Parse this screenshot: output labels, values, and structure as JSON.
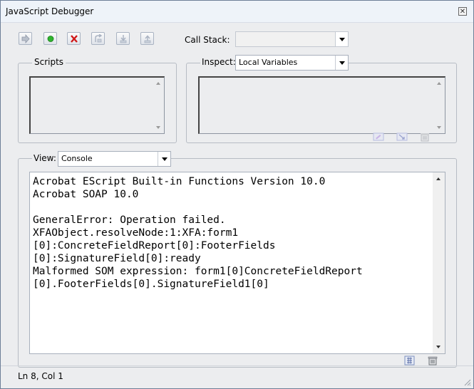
{
  "window": {
    "title": "JavaScript Debugger",
    "close_label": "✕"
  },
  "toolbar": {
    "buttons": [
      {
        "name": "resume",
        "icon": "resume-arrow-icon"
      },
      {
        "name": "interrupt",
        "icon": "green-dot-icon"
      },
      {
        "name": "quit",
        "icon": "red-x-icon"
      },
      {
        "name": "step-over",
        "icon": "step-over-icon"
      },
      {
        "name": "step-into",
        "icon": "step-into-icon"
      },
      {
        "name": "step-out",
        "icon": "step-out-icon"
      }
    ],
    "call_stack_label": "Call Stack:",
    "call_stack_value": ""
  },
  "scripts": {
    "title": "Scripts"
  },
  "inspect": {
    "label": "Inspect:",
    "selected": "Local Variables"
  },
  "view": {
    "label": "View:",
    "selected": "Console",
    "console_text": "Acrobat EScript Built-in Functions Version 10.0\nAcrobat SOAP 10.0\n\nGeneralError: Operation failed.\nXFAObject.resolveNode:1:XFA:form1\n[0]:ConcreteFieldReport[0]:FooterFields\n[0]:SignatureField[0]:ready\nMalformed SOM expression: form1[0]ConcreteFieldReport\n[0].FooterFields[0].SignatureField1[0]"
  },
  "status": {
    "text": "Ln 8, Col 1"
  }
}
